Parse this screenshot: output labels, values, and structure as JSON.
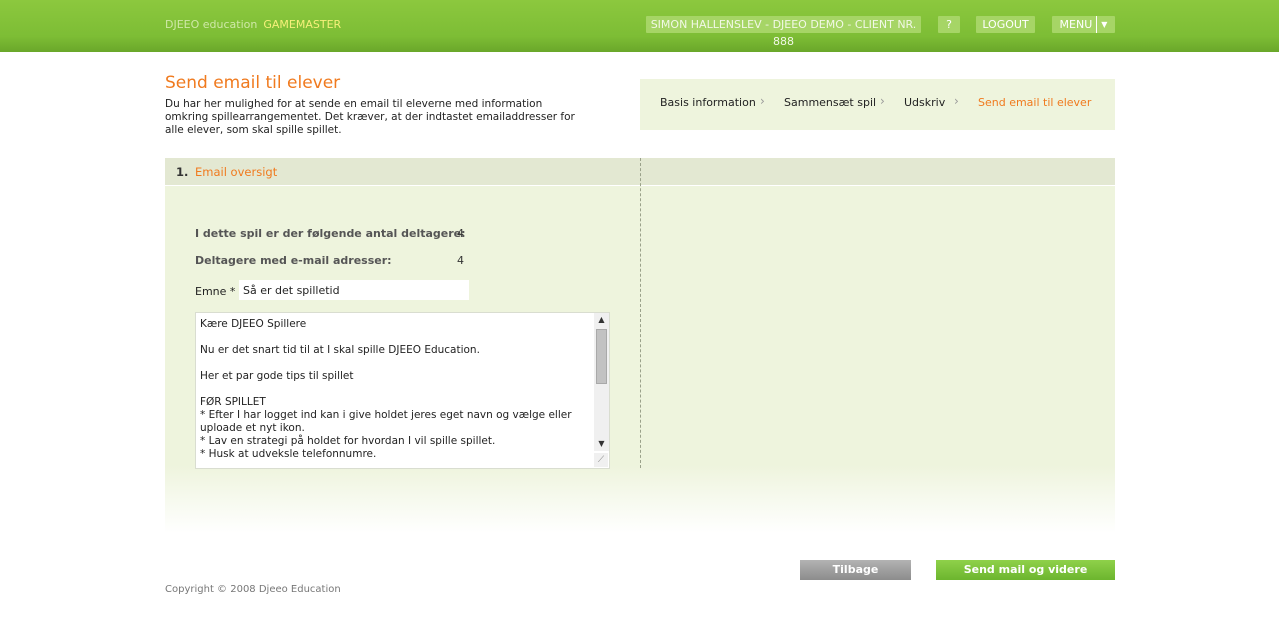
{
  "header": {
    "brand": "DJEEO education",
    "brand_highlight": "GAMEMASTER",
    "user": "SIMON HALLENSLEV - DJEEO DEMO - CLIENT NR. 888",
    "help_label": "?",
    "logout_label": "LOGOUT",
    "menu_label": "MENU"
  },
  "page": {
    "title": "Send email til elever",
    "intro": "Du har her mulighed for at sende en email til eleverne med information omkring spillearrangementet. Det kræver, at der indtastet emailaddresser for alle elever, som skal spille spillet."
  },
  "breadcrumb": {
    "items": [
      "Basis information",
      "Sammensæt spil",
      "Udskriv",
      "Send email til elever"
    ],
    "active_index": 3
  },
  "section": {
    "number": "1.",
    "title": "Email oversigt",
    "stats": [
      {
        "label": "I dette spil er der følgende antal deltagere:",
        "value": "4"
      },
      {
        "label": "Deltagere med e-mail adresser:",
        "value": "4"
      }
    ],
    "subject_label": "Emne *",
    "subject_value": "Så er det spilletid",
    "body_text": "Kære DJEEO Spillere\n\nNu er det snart tid til at I skal spille DJEEO Education.\n\nHer et par gode tips til spillet\n\nFØR SPILLET\n* Efter I har logget ind kan i give holdet jeres eget navn og vælge eller uploade et nyt ikon.\n* Lav en strategi på holdet for hvordan I vil spille spillet.\n* Husk at udveksle telefonnumre."
  },
  "buttons": {
    "back": "Tilbage",
    "send": "Send mail og videre"
  },
  "footer": {
    "copyright": "Copyright © 2008 Djeeo Education"
  },
  "colors": {
    "accent": "#f07a1e",
    "brand_green": "#7dbd35",
    "panel": "#eef4dd"
  }
}
